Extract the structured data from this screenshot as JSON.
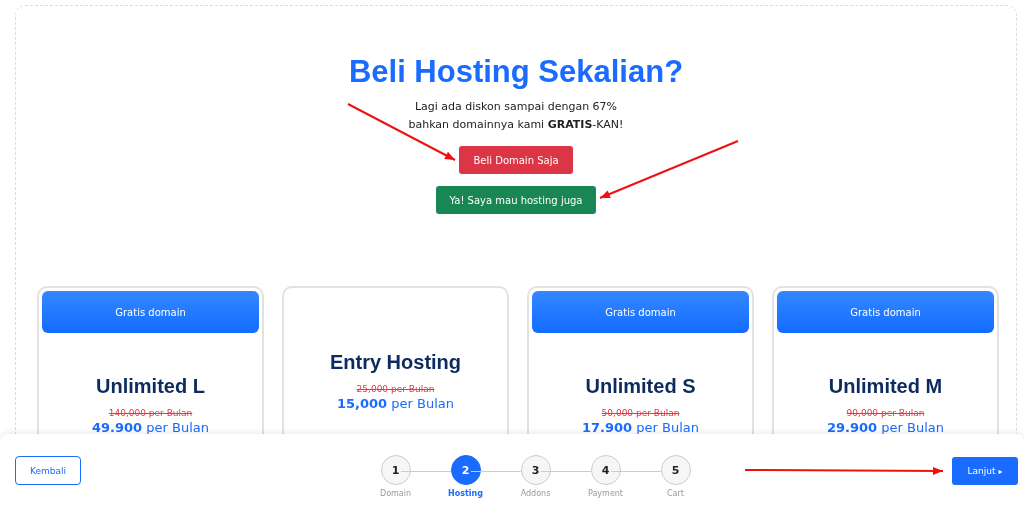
{
  "heading": "Beli Hosting Sekalian?",
  "subtitle": [
    "Lagi ada diskon sampai dengan 67%",
    "bahkan domainnya kami **GRATIS**-KAN!"
  ],
  "buttons": [
    {
      "label": "Beli Domain Saja",
      "kind": "danger"
    },
    {
      "label": "Ya! Saya mau hosting juga",
      "kind": "success"
    }
  ],
  "plans": [
    {
      "badge": "Gratis domain",
      "name": "Unlimited L",
      "old_price": "140,000 per Bulan",
      "price": "49.900",
      "unit": "per Bulan"
    },
    {
      "name": "Entry Hosting",
      "old_price": "25,000 per Bulan",
      "price": "15,000",
      "unit": "per Bulan"
    },
    {
      "badge": "Gratis domain",
      "name": "Unlimited S",
      "old_price": "50,000 per Bulan",
      "price": "17.900",
      "unit": "per Bulan"
    },
    {
      "badge": "Gratis domain",
      "name": "Unlimited M",
      "old_price": "90,000 per Bulan",
      "price": "29.900",
      "unit": "per Bulan"
    }
  ],
  "footer": {
    "back": "Kembali",
    "next": "Lanjut",
    "next_icon": "▸",
    "steps": [
      {
        "number": "1",
        "label": "Domain",
        "selected": false
      },
      {
        "number": "2",
        "label": "Hosting",
        "selected": true
      },
      {
        "number": "3",
        "label": "Addons",
        "selected": false
      },
      {
        "number": "4",
        "label": "Payment",
        "selected": false
      },
      {
        "number": "5",
        "label": "Cart",
        "selected": false
      }
    ]
  }
}
